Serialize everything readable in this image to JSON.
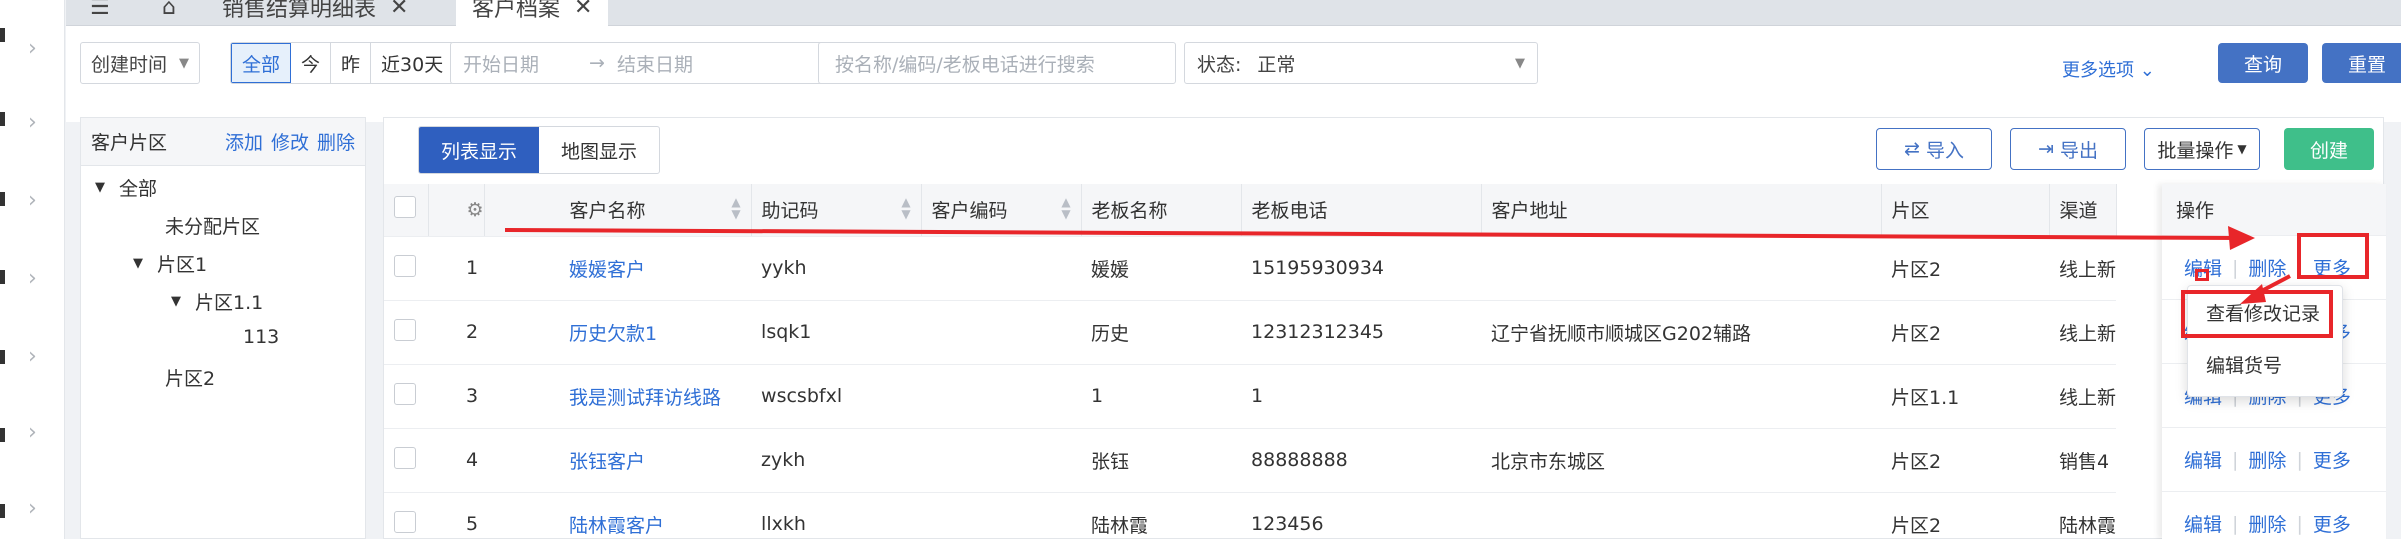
{
  "tabs": [
    {
      "label": "销售结算明细表"
    },
    {
      "label": "客户档案"
    }
  ],
  "filters": {
    "date_type": "创建时间",
    "date_segments": [
      "全部",
      "今",
      "昨",
      "近30天"
    ],
    "start_placeholder": "开始日期",
    "end_placeholder": "结束日期",
    "search_placeholder": "按名称/编码/老板电话进行搜索",
    "status_label": "状态:",
    "status_value": "正常",
    "more_options": "更多选项",
    "query_label": "查询",
    "reset_label": "重置"
  },
  "zone_panel": {
    "title": "客户片区",
    "add": "添加",
    "edit": "修改",
    "delete": "删除",
    "tree": [
      {
        "label": "全部",
        "expanded": true
      },
      {
        "label": "未分配片区"
      },
      {
        "label": "片区1",
        "expanded": true
      },
      {
        "label": "片区1.1",
        "expanded": true
      },
      {
        "label": "113"
      },
      {
        "label": "片区2"
      }
    ]
  },
  "toolbar": {
    "list_view": "列表显示",
    "map_view": "地图显示",
    "import": "导入",
    "export": "导出",
    "batch": "批量操作",
    "create": "创建"
  },
  "table": {
    "columns": [
      "客户名称",
      "助记码",
      "客户编码",
      "老板名称",
      "老板电话",
      "客户地址",
      "片区",
      "渠道",
      "操作"
    ],
    "rows": [
      {
        "no": "1",
        "name": "媛媛客户",
        "code": "yykh",
        "cust_code": "",
        "boss": "媛媛",
        "phone": "15195930934",
        "addr": "",
        "zone": "片区2",
        "channel": "线上新"
      },
      {
        "no": "2",
        "name": "历史欠款1",
        "code": "lsqk1",
        "cust_code": "",
        "boss": "历史",
        "phone": "12312312345",
        "addr": "辽宁省抚顺市顺城区G202辅路",
        "zone": "片区2",
        "channel": "线上新"
      },
      {
        "no": "3",
        "name": "我是测试拜访线路",
        "code": "wscsbfxl",
        "cust_code": "",
        "boss": "1",
        "phone": "1",
        "addr": "",
        "zone": "片区1.1",
        "channel": "线上新"
      },
      {
        "no": "4",
        "name": "张钰客户",
        "code": "zykh",
        "cust_code": "",
        "boss": "张钰",
        "phone": "88888888",
        "addr": "北京市东城区",
        "zone": "片区2",
        "channel": "销售4"
      },
      {
        "no": "5",
        "name": "陆林霞客户",
        "code": "llxkh",
        "cust_code": "",
        "boss": "陆林霞",
        "phone": "123456",
        "addr": "",
        "zone": "片区2",
        "channel": "陆林霞"
      }
    ],
    "ops": {
      "edit": "编辑",
      "delete": "删除",
      "more": "更多"
    }
  },
  "more_menu": [
    "查看修改记录",
    "编辑货号"
  ],
  "colors": {
    "accent": "#2f6fd6",
    "primary_btn": "#4472c4",
    "create_btn": "#3fbf8a",
    "highlight": "#e8262a"
  }
}
